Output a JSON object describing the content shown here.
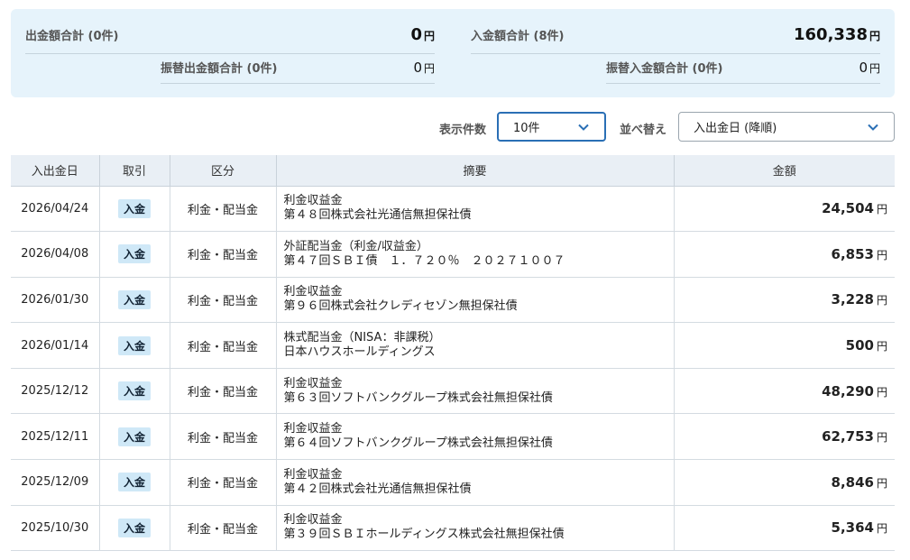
{
  "summary": {
    "withdraw_total_label": "出金額合計 (0件)",
    "withdraw_total_value": "0",
    "transfer_withdraw_label": "振替出金額合計 (0件)",
    "transfer_withdraw_value": "0",
    "deposit_total_label": "入金額合計 (8件)",
    "deposit_total_value": "160,338",
    "transfer_deposit_label": "振替入金額合計 (0件)",
    "transfer_deposit_value": "0",
    "currency": "円"
  },
  "controls": {
    "count_label": "表示件数",
    "count_value": "10件",
    "sort_label": "並べ替え",
    "sort_value": "入出金日 (降順)"
  },
  "table": {
    "headers": [
      "入出金日",
      "取引",
      "区分",
      "摘要",
      "金額"
    ],
    "rows": [
      {
        "date": "2026/04/24",
        "type": "入金",
        "category": "利金・配当金",
        "desc1": "利金収益金",
        "desc2": "第４８回株式会社光通信無担保社債",
        "amount": "24,504"
      },
      {
        "date": "2026/04/08",
        "type": "入金",
        "category": "利金・配当金",
        "desc1": "外証配当金（利金/収益金）",
        "desc2": "第４７回ＳＢＩ債　１．７２０％　２０２７１００７",
        "amount": "6,853"
      },
      {
        "date": "2026/01/30",
        "type": "入金",
        "category": "利金・配当金",
        "desc1": "利金収益金",
        "desc2": "第９６回株式会社クレディセゾン無担保社債",
        "amount": "3,228"
      },
      {
        "date": "2026/01/14",
        "type": "入金",
        "category": "利金・配当金",
        "desc1": "株式配当金（NISA：非課税）",
        "desc2": "日本ハウスホールディングス",
        "amount": "500"
      },
      {
        "date": "2025/12/12",
        "type": "入金",
        "category": "利金・配当金",
        "desc1": "利金収益金",
        "desc2": "第６３回ソフトバンクグループ株式会社無担保社債",
        "amount": "48,290"
      },
      {
        "date": "2025/12/11",
        "type": "入金",
        "category": "利金・配当金",
        "desc1": "利金収益金",
        "desc2": "第６４回ソフトバンクグループ株式会社無担保社債",
        "amount": "62,753"
      },
      {
        "date": "2025/12/09",
        "type": "入金",
        "category": "利金・配当金",
        "desc1": "利金収益金",
        "desc2": "第４２回株式会社光通信無担保社債",
        "amount": "8,846"
      },
      {
        "date": "2025/10/30",
        "type": "入金",
        "category": "利金・配当金",
        "desc1": "利金収益金",
        "desc2": "第３９回ＳＢＩホールディングス株式会社無担保社債",
        "amount": "5,364"
      }
    ]
  },
  "icons": {
    "dropdown": "chevron-down-icon"
  },
  "colors": {
    "summary_bg": "#e6f3fb",
    "header_bg": "#e9eff5",
    "badge_bg": "#cfe8f7",
    "focus_border": "#2a6fb5"
  }
}
